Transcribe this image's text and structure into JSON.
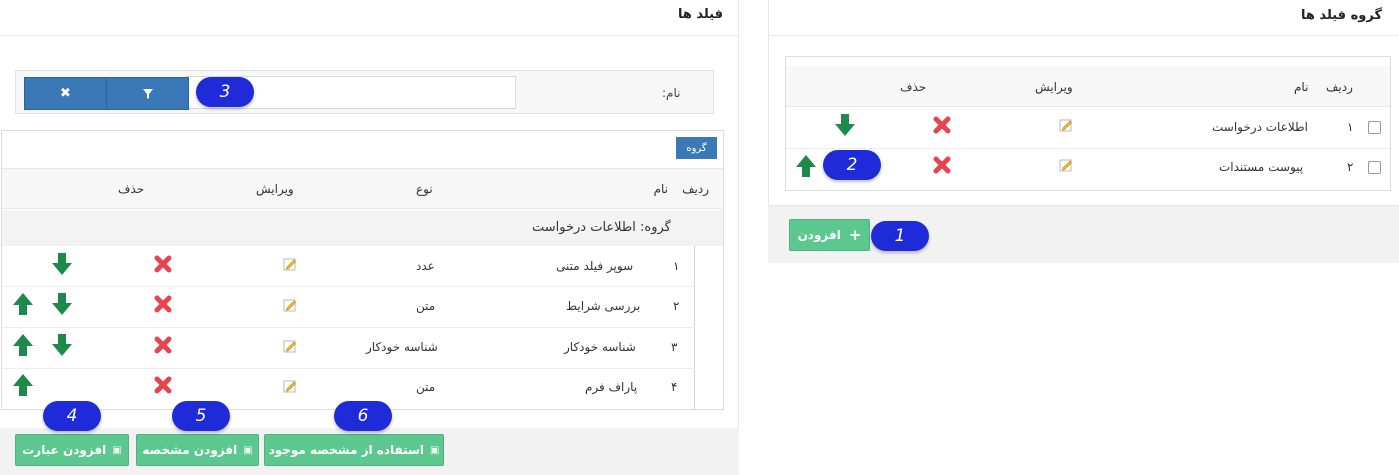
{
  "colors": {
    "primary": "#3a78b8",
    "success": "#5cc88f",
    "danger": "#e8434f",
    "arrow": "#1d8a4c",
    "callout": "#1f2ad9"
  },
  "fields_panel": {
    "title": "فیلد ها",
    "filter": {
      "label": "نام:",
      "value": "",
      "placeholder": ""
    },
    "group_tag": "گروه",
    "headers": {
      "row": "ردیف",
      "name": "نام",
      "type": "نوع",
      "edit": "ویرایش",
      "delete": "حذف"
    },
    "group_label": "گروه: اطلاعات درخواست",
    "rows": [
      {
        "num": "۱",
        "name": "سوپر فیلد متنی",
        "type": "عدد"
      },
      {
        "num": "۲",
        "name": "بررسی شرایط",
        "type": "متن"
      },
      {
        "num": "۳",
        "name": "شناسه خودکار",
        "type": "شناسه خودکار"
      },
      {
        "num": "۴",
        "name": "پاراف فرم",
        "type": "متن"
      }
    ],
    "footer_buttons": {
      "add_expression": "افزودن عبارت",
      "add_identifier": "افزودن مشخصه",
      "use_existing": "استفاده از مشخصه موجود"
    }
  },
  "groups_panel": {
    "title": "گروه فیلد ها",
    "headers": {
      "row": "ردیف",
      "name": "نام",
      "edit": "ویرایش",
      "delete": "حذف"
    },
    "rows": [
      {
        "num": "۱",
        "name": "اطلاعات درخواست"
      },
      {
        "num": "۲",
        "name": "پیوست مستندات"
      }
    ],
    "add_button": "افزودن"
  },
  "callouts": [
    "1",
    "2",
    "3",
    "4",
    "5",
    "6"
  ]
}
